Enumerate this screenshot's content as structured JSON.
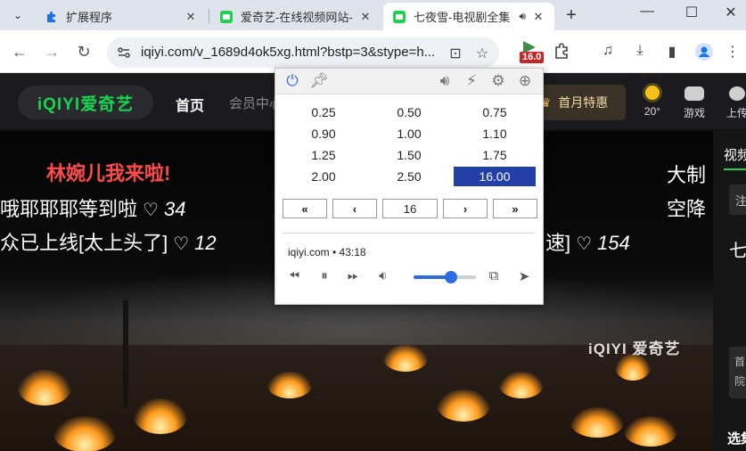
{
  "browser": {
    "tabs": [
      {
        "title": "扩展程序",
        "favicon": "puzzle-icon",
        "active": false
      },
      {
        "title": "爱奇艺-在线视频网站-海量...",
        "favicon": "iqiyi-icon",
        "active": false
      },
      {
        "title": "七夜雪-电视剧全集",
        "favicon": "iqiyi-icon",
        "active": true,
        "audio": true
      }
    ],
    "url": "iqiyi.com/v_1689d4ok5xg.html?bstp=3&stype=h...",
    "badge": "16.0",
    "colors": {
      "accent": "#2340a8",
      "badge_red": "#c62828",
      "ring": "#e32222"
    }
  },
  "site": {
    "logo": "iQIYI爱奇艺",
    "nav_home": "首页",
    "nav_vip": "会员中心",
    "promo": "首月特惠",
    "weather": "20°",
    "games": "游戏",
    "upload": "上传",
    "watermark": "iQIYI 爱奇艺",
    "side_tab": "视频",
    "side_letters": [
      "注",
      "七",
      "首",
      "院",
      "选集"
    ],
    "danmu": [
      {
        "text": "林婉儿我来啦!",
        "count": ""
      },
      {
        "text": "哦耶耶耶等到啦",
        "count": "34"
      },
      {
        "text": "众已上线[太上头了]",
        "count": "12"
      },
      {
        "text": "速]",
        "count": "154"
      },
      {
        "text": "大制",
        "count": ""
      },
      {
        "text": "空降",
        "count": ""
      }
    ]
  },
  "popup": {
    "speeds": [
      [
        "0.25",
        "0.50",
        "0.75"
      ],
      [
        "0.90",
        "1.00",
        "1.10"
      ],
      [
        "1.25",
        "1.50",
        "1.75"
      ],
      [
        "2.00",
        "2.50",
        "16.00"
      ]
    ],
    "selected_speed": "16.00",
    "controls": {
      "rewind_fast": "«",
      "rewind": "‹",
      "value": "16",
      "forward": "›",
      "forward_fast": "»"
    },
    "site_info": "iqiyi.com • 43:18",
    "volume_fraction": 0.6
  }
}
